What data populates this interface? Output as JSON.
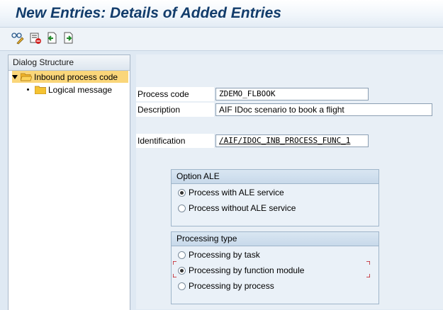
{
  "window": {
    "title": "New Entries: Details of Added Entries"
  },
  "toolbar": {
    "buttons": [
      {
        "icon": "glasses-change-icon"
      },
      {
        "icon": "delete-entry-icon"
      },
      {
        "icon": "previous-entry-icon"
      },
      {
        "icon": "next-entry-icon"
      }
    ]
  },
  "dialog_structure": {
    "header": "Dialog Structure",
    "items": [
      {
        "label": "Inbound process code",
        "expanded": true,
        "selected": true
      },
      {
        "label": "Logical message",
        "selected": false
      }
    ]
  },
  "form": {
    "process_code": {
      "label": "Process code",
      "value": "ZDEMO_FLBOOK"
    },
    "description": {
      "label": "Description",
      "value": "AIF IDoc scenario to book a flight"
    },
    "identification": {
      "label": "Identification",
      "value": "/AIF/IDOC_INB_PROCESS_FUNC_1"
    }
  },
  "option_ale": {
    "title": "Option ALE",
    "options": [
      {
        "label": "Process with ALE service",
        "checked": true
      },
      {
        "label": "Process without ALE service",
        "checked": false
      }
    ]
  },
  "processing_type": {
    "title": "Processing type",
    "options": [
      {
        "label": "Processing by task",
        "checked": false
      },
      {
        "label": "Processing by function module",
        "checked": true
      },
      {
        "label": "Processing by process",
        "checked": false
      }
    ]
  },
  "colors": {
    "title_text": "#123c6b",
    "selection": "#fad67a",
    "folder": "#f5c332",
    "focus_bracket": "#c0141c"
  }
}
